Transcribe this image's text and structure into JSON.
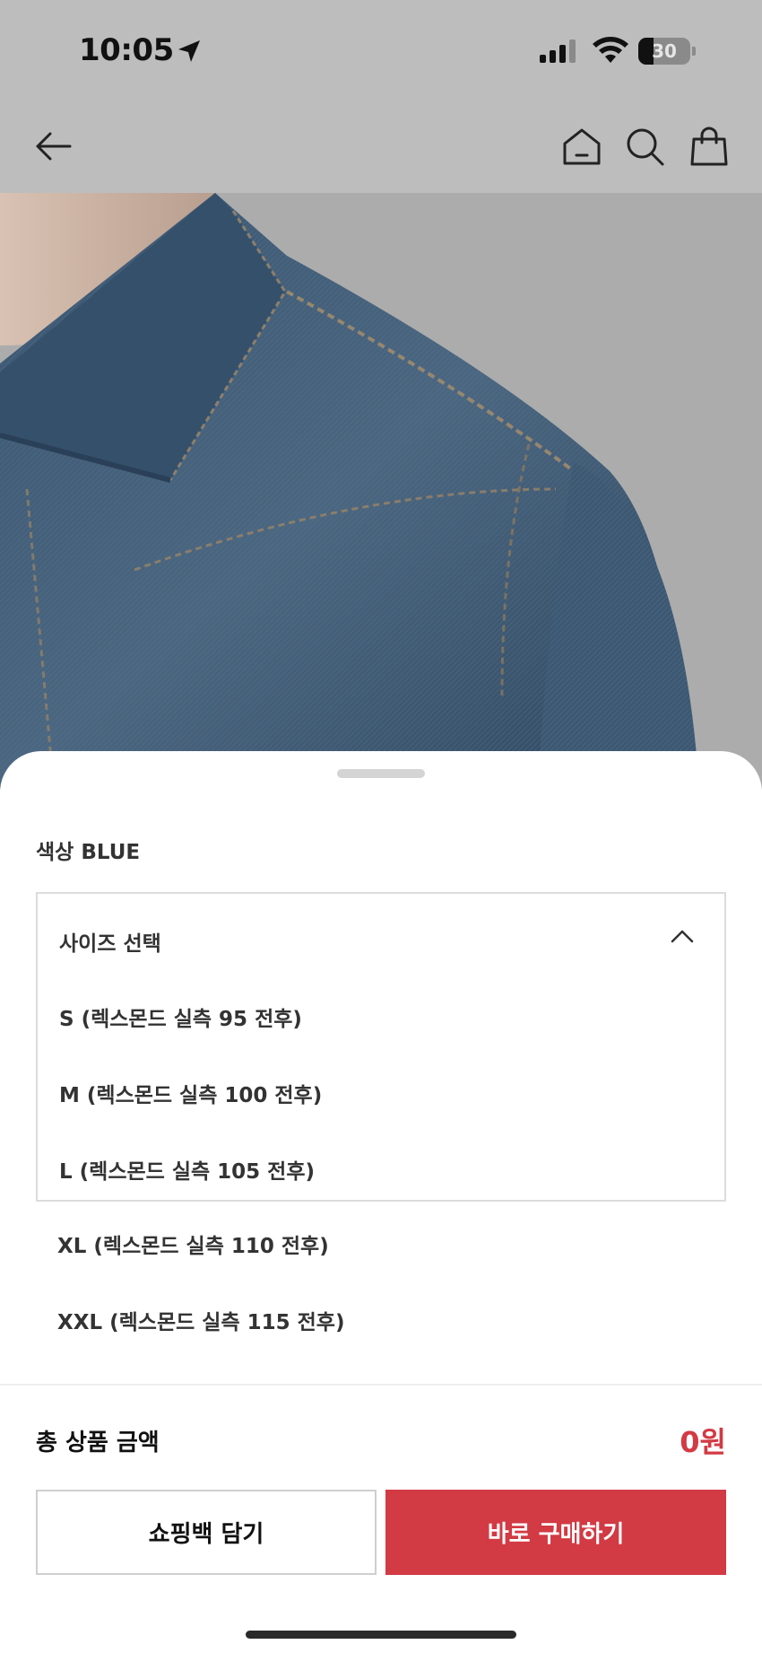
{
  "status_bar": {
    "time": "10:05",
    "battery_level": "30"
  },
  "nav": {
    "icons": [
      "back-arrow-icon",
      "home-icon",
      "search-icon",
      "shopping-bag-icon"
    ]
  },
  "sheet": {
    "color_label": "색상 BLUE",
    "size_select": {
      "label": "사이즈 선택",
      "expanded": true,
      "options": [
        "S (렉스몬드 실측 95 전후)",
        "M (렉스몬드 실측 100 전후)",
        "L (렉스몬드 실측 105 전후)",
        "XL (렉스몬드 실측 110 전후)",
        "XXL (렉스몬드 실측 115 전후)"
      ]
    },
    "total": {
      "label": "총 상품 금액",
      "value": "0원"
    },
    "buttons": {
      "add_to_bag": "쇼핑백 담기",
      "buy_now": "바로 구매하기"
    }
  },
  "colors": {
    "accent": "#d23a44",
    "backdrop": "#bdbdbd"
  }
}
